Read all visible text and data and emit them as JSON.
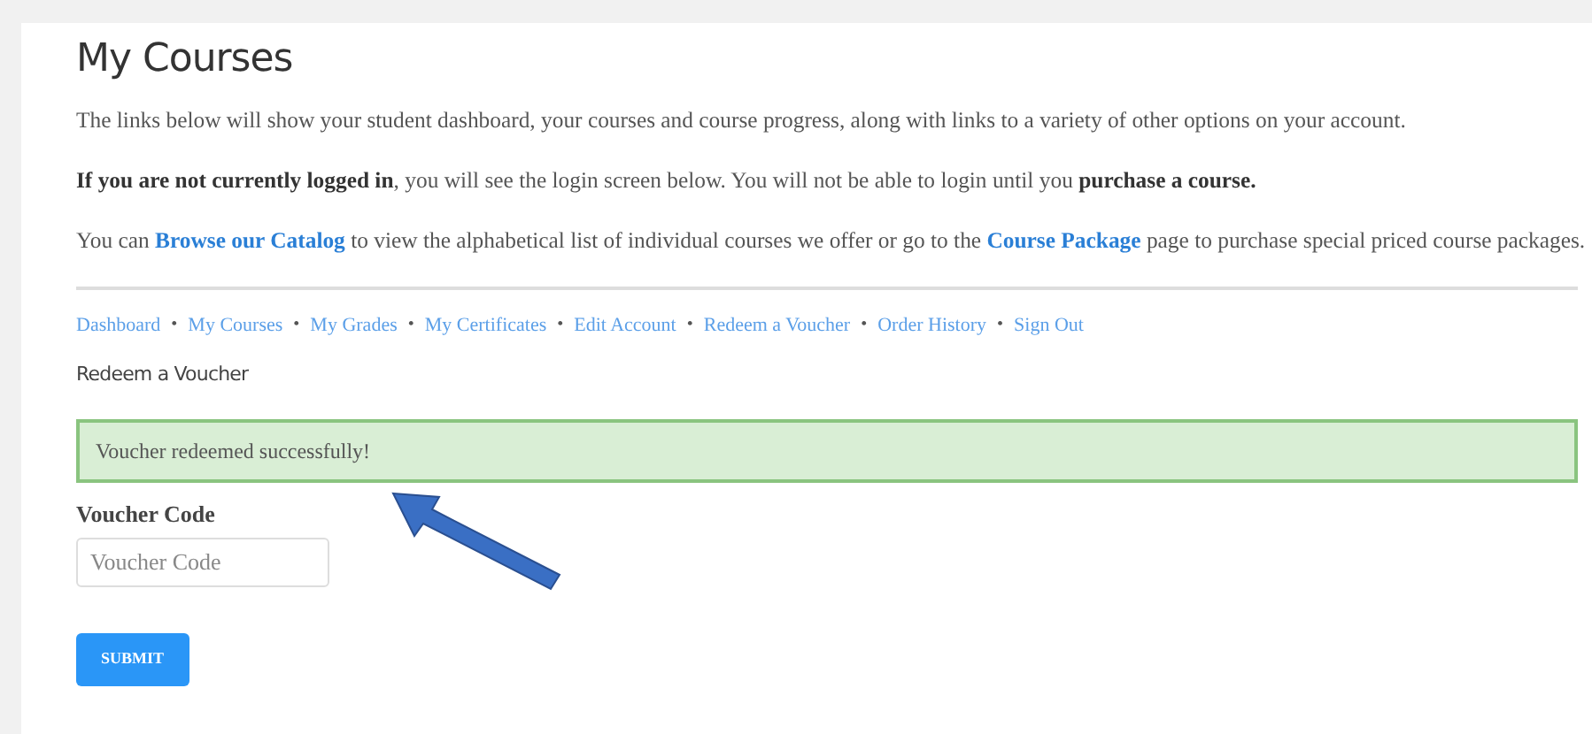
{
  "title": "My Courses",
  "paragraphs": [
    [
      {
        "kind": "text",
        "text": "The links below will show your student dashboard, your courses and course progress, along with links to a variety of other options on your account."
      }
    ],
    [
      {
        "kind": "text",
        "text": "**If you are not currently logged in**, you will see the login screen below. You will not be able to login until you **purchase a course.**"
      }
    ],
    [
      {
        "kind": "text",
        "text": "You can "
      },
      {
        "kind": "link",
        "text": "Browse our Catalog"
      },
      {
        "kind": "text",
        "text": " to view the alphabetical list of individual courses we offer or go to the "
      },
      {
        "kind": "link",
        "text": "Course Package"
      },
      {
        "kind": "text",
        "text": " page to purchase special priced course packages."
      }
    ]
  ],
  "nav": {
    "separator": "•",
    "links": [
      "Dashboard",
      "My Courses",
      "My Grades",
      "My Certificates",
      "Edit Account",
      "Redeem a Voucher",
      "Order History",
      "Sign Out"
    ]
  },
  "section_title": "Redeem a Voucher",
  "alert": {
    "text": "Voucher redeemed successfully!"
  },
  "form": {
    "label": "Voucher Code",
    "placeholder": "Voucher Code",
    "button": "SUBMIT"
  }
}
